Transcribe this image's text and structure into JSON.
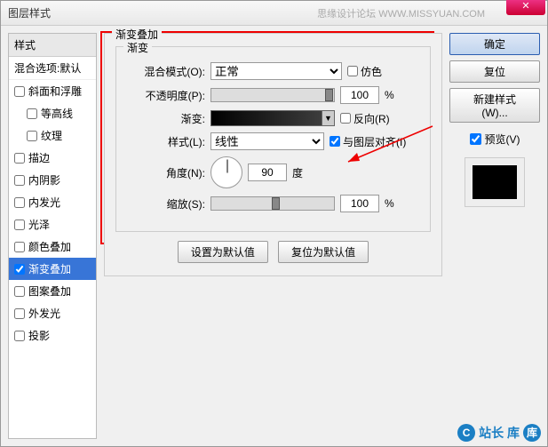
{
  "dialog": {
    "title": "图层样式"
  },
  "watermark_top": "思缘设计论坛 WWW.MISSYUAN.COM",
  "left": {
    "header": "样式",
    "sub": "混合选项:默认",
    "items": [
      {
        "label": "斜面和浮雕",
        "checked": false,
        "indent": false
      },
      {
        "label": "等高线",
        "checked": false,
        "indent": true
      },
      {
        "label": "纹理",
        "checked": false,
        "indent": true
      },
      {
        "label": "描边",
        "checked": false,
        "indent": false
      },
      {
        "label": "内阴影",
        "checked": false,
        "indent": false
      },
      {
        "label": "内发光",
        "checked": false,
        "indent": false
      },
      {
        "label": "光泽",
        "checked": false,
        "indent": false
      },
      {
        "label": "颜色叠加",
        "checked": false,
        "indent": false
      },
      {
        "label": "渐变叠加",
        "checked": true,
        "indent": false,
        "active": true
      },
      {
        "label": "图案叠加",
        "checked": false,
        "indent": false
      },
      {
        "label": "外发光",
        "checked": false,
        "indent": false
      },
      {
        "label": "投影",
        "checked": false,
        "indent": false
      }
    ]
  },
  "center": {
    "group_title": "渐变叠加",
    "inner_title": "渐变",
    "blend_mode_label": "混合模式(O):",
    "blend_mode_value": "正常",
    "dither_label": "仿色",
    "opacity_label": "不透明度(P):",
    "opacity_value": "100",
    "pct": "%",
    "gradient_label": "渐变:",
    "reverse_label": "反向(R)",
    "style_label": "样式(L):",
    "style_value": "线性",
    "align_label": "与图层对齐(I)",
    "align_checked": true,
    "angle_label": "角度(N):",
    "angle_value": "90",
    "deg": "度",
    "scale_label": "缩放(S):",
    "scale_value": "100",
    "reset_btn": "设置为默认值",
    "restore_btn": "复位为默认值"
  },
  "right": {
    "ok": "确定",
    "cancel": "复位",
    "new_style": "新建样式(W)...",
    "preview_label": "预览(V)",
    "preview_checked": true
  },
  "watermark_bottom": "站长 库"
}
